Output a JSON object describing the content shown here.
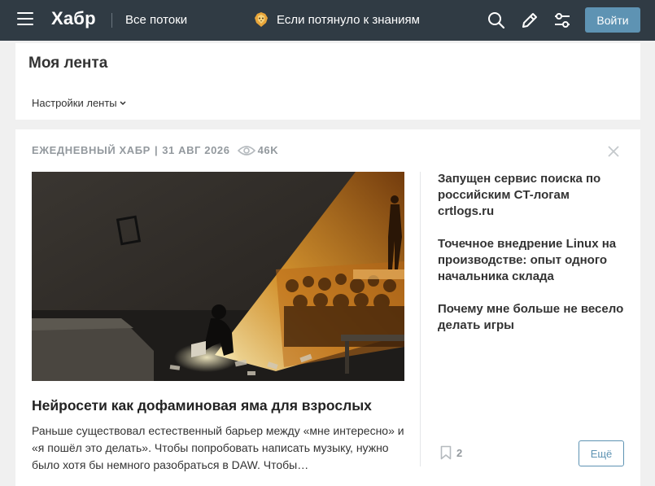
{
  "header": {
    "logo": "Хабр",
    "all_streams": "Все потоки",
    "promo_text": "Если потянуло к знаниям",
    "login_label": "Войти",
    "icons": [
      "menu-icon",
      "search-icon",
      "pencil-icon",
      "settings-sliders-icon"
    ]
  },
  "feed": {
    "title": "Моя лента",
    "settings_label": "Настройки ленты"
  },
  "digest": {
    "source": "ЕЖЕДНЕВНЫЙ ХАБР",
    "separator": "|",
    "date": "31 АВГ 2026",
    "views": "46K",
    "main_article": {
      "title": "Нейросети как дофаминовая яма для взрослых",
      "lead": "Раньше существовал естественный барьер между «мне интересно» и «я пошёл это делать». Чтобы попробовать написать музыку, нужно было хотя бы немного разобраться в DAW. Чтобы…"
    },
    "side_articles": [
      {
        "title": "Запущен сервис поиска по российским CT-логам crtlogs.ru"
      },
      {
        "title": "Точечное внедрение Linux на производстве: опыт одного начальника склада"
      },
      {
        "title": "Почему мне больше не весело делать игры"
      }
    ],
    "bookmarks_count": "2",
    "more_label": "Ещё"
  },
  "colors": {
    "header_bg": "#303b44",
    "accent": "#5e93b3",
    "meta_gray": "#93999e"
  }
}
